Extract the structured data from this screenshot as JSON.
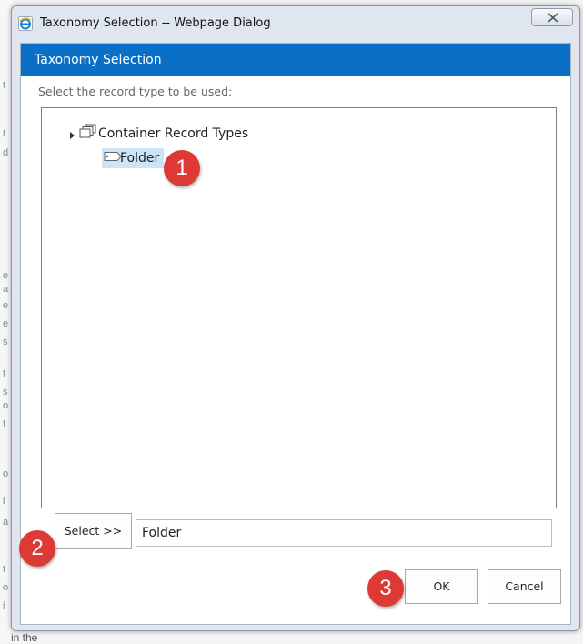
{
  "window": {
    "title": "Taxonomy Selection -- Webpage Dialog"
  },
  "dialog": {
    "header": "Taxonomy Selection",
    "instruction": "Select the record type to be used:"
  },
  "tree": {
    "root": {
      "label": "Container Record Types",
      "icon": "stacked-folders-icon",
      "expandable": true
    },
    "children": [
      {
        "label": "Folder",
        "icon": "tag-icon",
        "selected": true
      }
    ]
  },
  "selection": {
    "button_label": "Select >>",
    "value": "Folder"
  },
  "actions": {
    "ok_label": "OK",
    "cancel_label": "Cancel"
  },
  "callouts": [
    "1",
    "2",
    "3"
  ],
  "background": {
    "fragments": [
      "t",
      "r",
      "d",
      "e",
      "a",
      "e",
      "e",
      "s",
      "t",
      "s",
      "o",
      "t",
      "o",
      "i",
      "a",
      "t",
      "o",
      "i"
    ],
    "bottom_text": "in the"
  },
  "colors": {
    "header_bar": "#0a6fc7",
    "selected_item": "#cce4f7",
    "callout": "#dd3a35"
  }
}
